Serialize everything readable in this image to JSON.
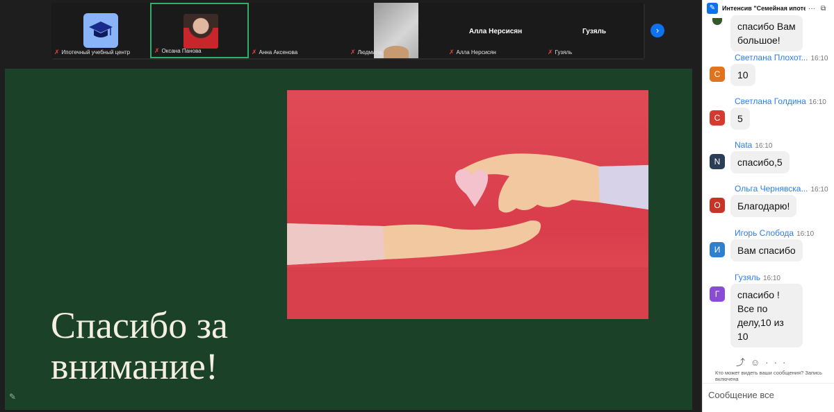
{
  "video_strip": {
    "participants": [
      {
        "name": "Ипотечный учебный центр",
        "muted": true,
        "icon": "graduation-cap-icon"
      },
      {
        "name": "Оксана Панова",
        "muted": true,
        "active_speaker": true
      },
      {
        "name": "Анна Аксенова",
        "muted": true
      },
      {
        "name": "Людмила",
        "muted": true
      },
      {
        "name": "Алла Нерсисян",
        "label": "Алла Нерсисян",
        "muted": true
      },
      {
        "name": "Гузяль",
        "label": "Гузяль",
        "muted": true
      }
    ],
    "next_icon": "chevron-right-icon"
  },
  "slide": {
    "title_line1": "Спасибо за",
    "title_line2": "внимание!",
    "image_description_icon": "heart-hands-image",
    "background_color": "#1b4228",
    "image_color": "#e04a56"
  },
  "chat": {
    "header_title": "Интенсив \"Семейная ипоте...",
    "more_icon": "more-icon",
    "popout_icon": "popout-icon",
    "messages": [
      {
        "sender": "",
        "time": "",
        "text_lines": [
          "спасибо Вам",
          "большое!"
        ],
        "initial": "",
        "color": "#35572a"
      },
      {
        "sender": "Светлана Плохот...",
        "time": "16:10",
        "text_lines": [
          "10"
        ],
        "initial": "С",
        "color": "#e0731b"
      },
      {
        "sender": "Светлана Голдина",
        "time": "16:10",
        "text_lines": [
          "5"
        ],
        "initial": "С",
        "color": "#d43a2f"
      },
      {
        "sender": "Nata",
        "time": "16:10",
        "text_lines": [
          "спасибо,5"
        ],
        "initial": "N",
        "color": "#2c3e55"
      },
      {
        "sender": "Ольга Чернявска...",
        "time": "16:10",
        "text_lines": [
          "Благодарю!"
        ],
        "initial": "О",
        "color": "#c83328"
      },
      {
        "sender": "Игорь Слобода",
        "time": "16:10",
        "text_lines": [
          "Вам спасибо"
        ],
        "initial": "И",
        "color": "#2f7fcf"
      },
      {
        "sender": "Гузяль",
        "time": "16:10",
        "text_lines": [
          "спасибо !",
          "Все по",
          "делу,10 из",
          "10"
        ],
        "initial": "Г",
        "color": "#8a4bd6"
      }
    ],
    "notice": "Кто может видеть ваши сообщения? Запись включена",
    "input_placeholder": "Сообщение все"
  }
}
